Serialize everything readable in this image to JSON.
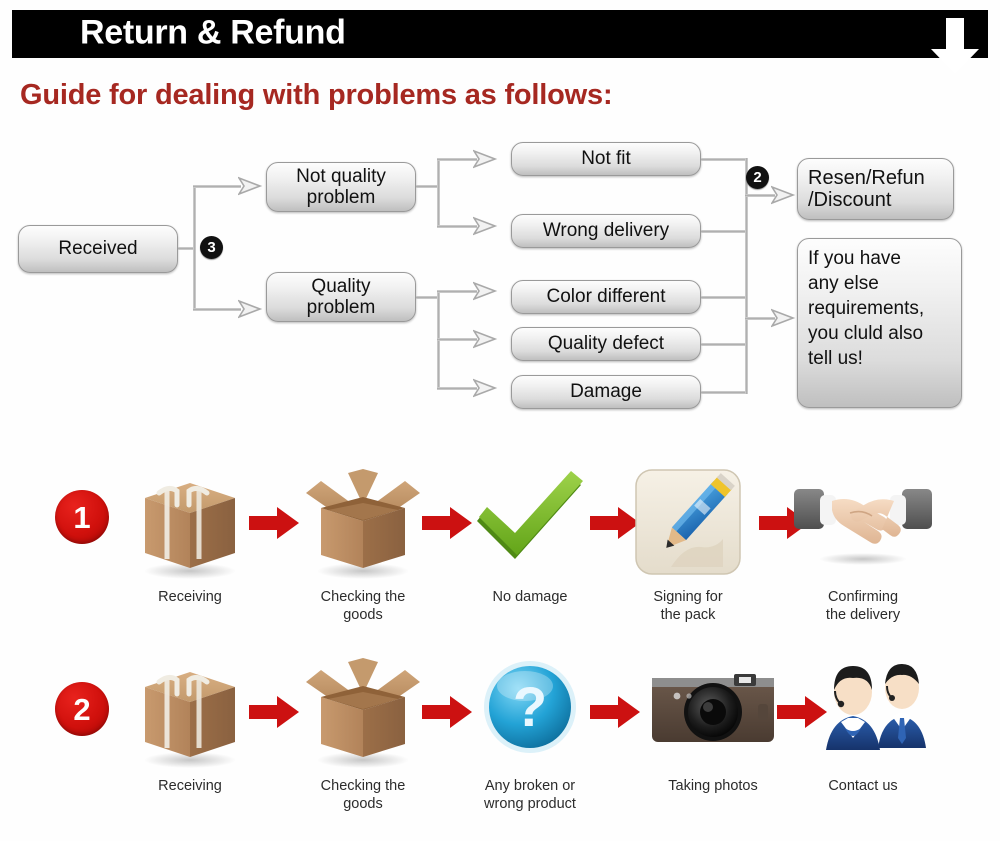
{
  "header": {
    "title": "Return & Refund",
    "download_icon": "download-arrow-icon"
  },
  "guide": {
    "heading": "Guide for dealing with problems as follows:",
    "accent_color": "#A62821"
  },
  "flowchart": {
    "start": "Received",
    "badge_three": "3",
    "badge_two": "2",
    "categories": [
      {
        "label": "Not quality\nproblem"
      },
      {
        "label": "Quality\nproblem"
      }
    ],
    "issues": [
      {
        "label": "Not fit"
      },
      {
        "label": "Wrong delivery"
      },
      {
        "label": "Color different"
      },
      {
        "label": "Quality defect"
      },
      {
        "label": "Damage"
      }
    ],
    "outcomes": [
      {
        "label": "Resen/Refun\n/Discount"
      },
      {
        "label": "If you have\nany else\nrequirements,\nyou cluld also\ntell us!"
      }
    ]
  },
  "steps": {
    "arrow_color": "#CC1111",
    "rows": [
      {
        "number": "1",
        "items": [
          {
            "icon": "closed-box-icon",
            "caption": "Receiving"
          },
          {
            "icon": "open-box-icon",
            "caption": "Checking the\ngoods"
          },
          {
            "icon": "green-check-icon",
            "caption": "No damage"
          },
          {
            "icon": "pencil-sign-icon",
            "caption": "Signing for\nthe pack"
          },
          {
            "icon": "handshake-icon",
            "caption": "Confirming\nthe delivery"
          }
        ]
      },
      {
        "number": "2",
        "items": [
          {
            "icon": "closed-box-icon",
            "caption": "Receiving"
          },
          {
            "icon": "open-box-icon",
            "caption": "Checking the\ngoods"
          },
          {
            "icon": "question-mark-icon",
            "caption": "Any broken or\nwrong product"
          },
          {
            "icon": "camera-icon",
            "caption": "Taking photos"
          },
          {
            "icon": "support-agents-icon",
            "caption": "Contact us"
          }
        ]
      }
    ]
  }
}
